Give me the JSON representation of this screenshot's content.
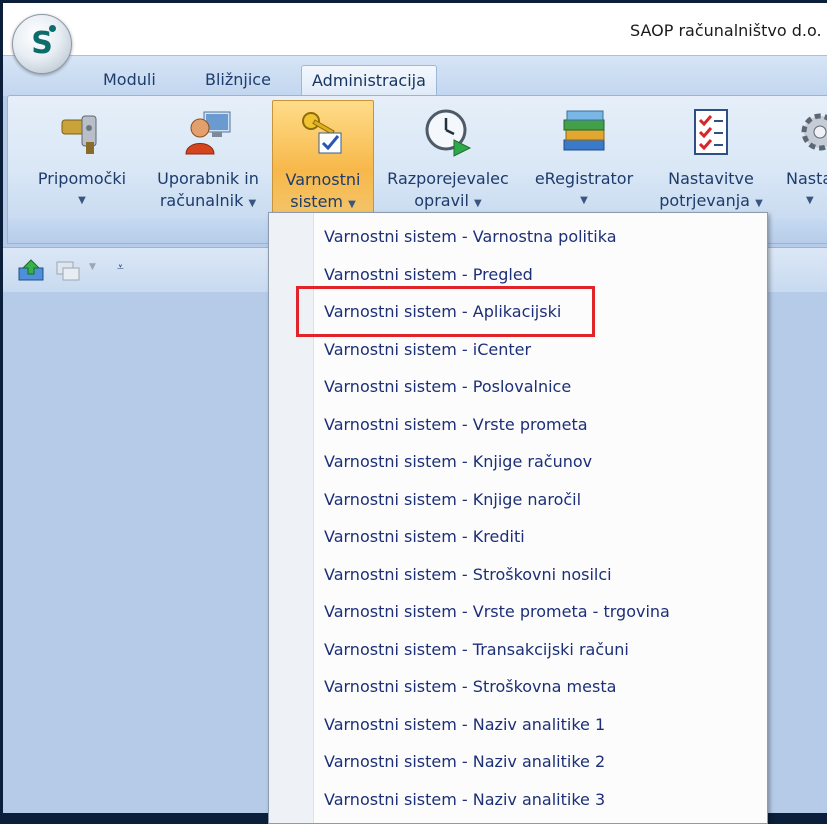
{
  "window": {
    "title": "SAOP računalništvo d.o."
  },
  "tabs": [
    {
      "label": "Moduli",
      "active": false
    },
    {
      "label": "Bližnjice",
      "active": false
    },
    {
      "label": "Administracija",
      "active": true
    }
  ],
  "ribbon": {
    "buttons": [
      {
        "line1": "Pripomočki",
        "line2": "",
        "icon": "tools-icon"
      },
      {
        "line1": "Uporabnik in",
        "line2": "računalnik",
        "icon": "user-computer-icon"
      },
      {
        "line1": "Varnostni",
        "line2": "sistem",
        "icon": "security-keys-icon",
        "pressed": true
      },
      {
        "line1": "Razporejevalec",
        "line2": "opravil",
        "icon": "clock-play-icon"
      },
      {
        "line1": "eRegistrator",
        "line2": "",
        "icon": "books-icon"
      },
      {
        "line1": "Nastavitve",
        "line2": "potrjevanja",
        "icon": "checklist-icon"
      },
      {
        "line1": "Nasta",
        "line2": "",
        "icon": "gear-icon"
      }
    ]
  },
  "menu": {
    "items": [
      "Varnostni sistem - Varnostna politika",
      "Varnostni sistem - Pregled",
      "Varnostni sistem - Aplikacijski",
      "Varnostni sistem - iCenter",
      "Varnostni sistem - Poslovalnice",
      "Varnostni sistem - Vrste prometa",
      "Varnostni sistem - Knjige računov",
      "Varnostni sistem - Knjige naročil",
      "Varnostni sistem - Krediti",
      "Varnostni sistem - Stroškovni nosilci",
      "Varnostni sistem - Vrste prometa - trgovina",
      "Varnostni sistem - Transakcijski računi",
      "Varnostni sistem - Stroškovna mesta",
      "Varnostni sistem - Naziv analitike 1",
      "Varnostni sistem - Naziv analitike 2",
      "Varnostni sistem - Naziv analitike 3"
    ],
    "highlighted_index": 2,
    "highlight_color": "#e0242a"
  },
  "colors": {
    "accent": "#f7b84a",
    "menu_text": "#1c2f78",
    "ribbon_text": "#1d3c6b"
  }
}
